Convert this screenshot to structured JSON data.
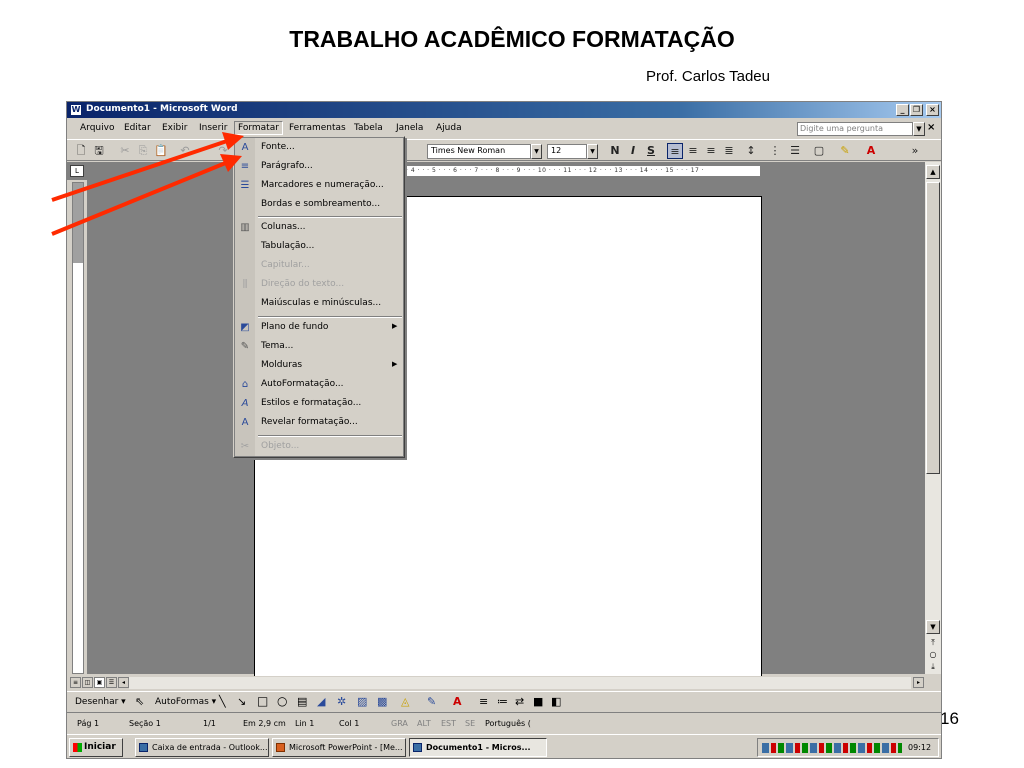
{
  "slide": {
    "title": "TRABALHO ACADÊMICO FORMATAÇÃO",
    "subtitle": "Prof. Carlos Tadeu",
    "page_number": "16"
  },
  "window": {
    "title": "Documento1 - Microsoft Word"
  },
  "menubar": {
    "items": [
      "Arquivo",
      "Editar",
      "Exibir",
      "Inserir",
      "Formatar",
      "Ferramentas",
      "Tabela",
      "Janela",
      "Ajuda"
    ],
    "help_placeholder": "Digite uma pergunta"
  },
  "toolbar": {
    "font": "Times New Roman",
    "size": "12",
    "bold": "N",
    "italic": "I",
    "underline": "S"
  },
  "ruler": {
    "text": "· 4 · · · 5 · · · 6 · · · 7 · · · 8 · · · 9 · · · 10 · · · 11 · · · 12 · · · 13 · · · 14 · · · 15 · · · 17 ·"
  },
  "format_menu": {
    "items": [
      {
        "label": "Fonte...",
        "icon": "font-A-icon",
        "glyph": "A",
        "enabled": true
      },
      {
        "label": "Parágrafo...",
        "icon": "paragraph-icon",
        "glyph": "≡",
        "enabled": true
      },
      {
        "label": "Marcadores e numeração...",
        "icon": "bullets-icon",
        "glyph": "☰",
        "enabled": true
      },
      {
        "label": "Bordas e sombreamento...",
        "icon": "",
        "glyph": "",
        "enabled": true
      },
      {
        "label": "Colunas...",
        "icon": "columns-icon",
        "glyph": "▥",
        "enabled": true
      },
      {
        "label": "Tabulação...",
        "icon": "",
        "glyph": "",
        "enabled": true
      },
      {
        "label": "Capitular...",
        "icon": "",
        "glyph": "",
        "enabled": false
      },
      {
        "label": "Direção do texto...",
        "icon": "text-direction-icon",
        "glyph": "⫼",
        "enabled": false
      },
      {
        "label": "Maiúsculas e minúsculas...",
        "icon": "",
        "glyph": "",
        "enabled": true
      },
      {
        "label": "Plano de fundo",
        "icon": "background-icon",
        "glyph": "◩",
        "enabled": true,
        "submenu": true
      },
      {
        "label": "Tema...",
        "icon": "theme-icon",
        "glyph": "✎",
        "enabled": true
      },
      {
        "label": "Molduras",
        "icon": "",
        "glyph": "",
        "enabled": true,
        "submenu": true
      },
      {
        "label": "AutoFormatação...",
        "icon": "autoformat-icon",
        "glyph": "⌂",
        "enabled": true
      },
      {
        "label": "Estilos e formatação...",
        "icon": "styles-icon",
        "glyph": "A",
        "enabled": true
      },
      {
        "label": "Revelar formatação...",
        "icon": "reveal-formatting-icon",
        "glyph": "A",
        "enabled": true
      },
      {
        "label": "Objeto...",
        "icon": "object-icon",
        "glyph": "✂",
        "enabled": false
      }
    ]
  },
  "draw_toolbar": {
    "draw_label": "Desenhar ▾",
    "autoshapes_label": "AutoFormas ▾"
  },
  "statusbar": {
    "page": "Pág 1",
    "section": "Seção 1",
    "pages": "1/1",
    "position": "Em 2,9 cm",
    "line": "Lin 1",
    "col": "Col 1",
    "rec": "GRA",
    "alt": "ALT",
    "ext": "EST",
    "ovr": "SE",
    "language": "Português ("
  },
  "taskbar": {
    "start_label": "Iniciar",
    "tasks": [
      "Caixa de entrada - Outlook...",
      "Microsoft PowerPoint - [Me...",
      "Documento1 - Micros..."
    ],
    "clock": "09:12"
  },
  "colors": {
    "titlebar": "#0a246a",
    "arrow": "#ff2a00",
    "chrome": "#d4d0c8"
  }
}
